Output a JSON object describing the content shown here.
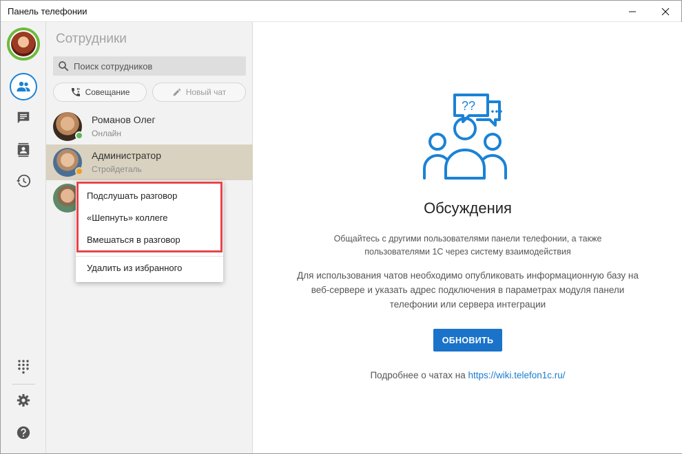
{
  "window": {
    "title": "Панель телефонии",
    "minimize_icon": "minimize-icon",
    "close_icon": "close-icon"
  },
  "rail": {
    "items": [
      {
        "name": "employees",
        "icon": "people-icon",
        "active": true
      },
      {
        "name": "chats",
        "icon": "chat-icon",
        "active": false
      },
      {
        "name": "contacts",
        "icon": "contact-book-icon",
        "active": false
      },
      {
        "name": "history",
        "icon": "history-icon",
        "active": false
      }
    ],
    "bottom": [
      {
        "name": "dialpad",
        "icon": "dialpad-icon"
      },
      {
        "name": "settings",
        "icon": "gear-icon"
      },
      {
        "name": "help",
        "icon": "help-icon"
      }
    ],
    "accent_color": "#1a82d6",
    "avatar_status_color": "#6dba3f"
  },
  "contacts": {
    "title": "Сотрудники",
    "search_placeholder": "Поиск сотрудников",
    "conference_label": "Совещание",
    "new_chat_label": "Новый чат",
    "items": [
      {
        "name": "Романов Олег",
        "status": "Онлайн",
        "status_color": "#5cb85c",
        "selected": false
      },
      {
        "name": "Администратор",
        "status": "Стройдеталь",
        "status_color": "#f0a020",
        "selected": true
      },
      {
        "name": "",
        "status": "",
        "status_color": "",
        "selected": false
      }
    ]
  },
  "context_menu": {
    "items": [
      "Подслушать разговор",
      "«Шепнуть» коллеге",
      "Вмешаться в разговор"
    ],
    "secondary_item": "Удалить из избранного",
    "highlight_color": "#e8434a"
  },
  "main": {
    "title": "Обсуждения",
    "paragraph1": "Общайтесь с другими пользователями панели телефонии, а также пользователями 1С через систему взаимодействия",
    "paragraph2": "Для использования чатов необходимо опубликовать информационную базу на веб-сервере и указать адрес подключения в параметрах модуля панели телефонии или сервера интеграции",
    "refresh_button": "ОБНОВИТЬ",
    "more_prefix": "Подробнее о чатах на ",
    "more_link": "https://wiki.telefon1c.ru/",
    "illustration_icon": "discussion-people-icon",
    "accent_color": "#1a82d6"
  }
}
